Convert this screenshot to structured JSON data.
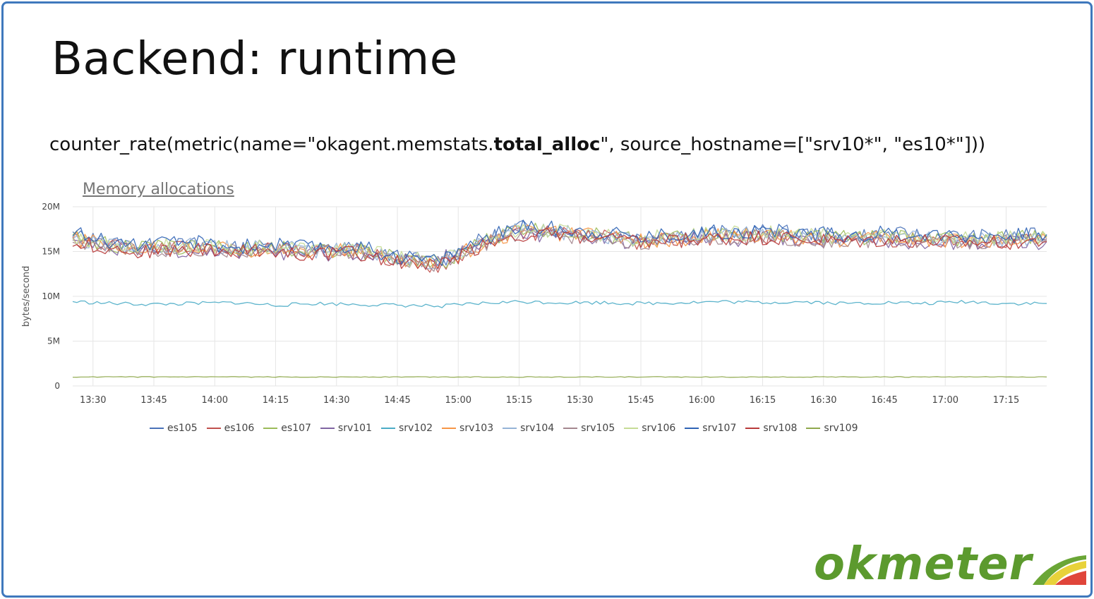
{
  "slide": {
    "title": "Backend: runtime",
    "query": {
      "prefix": "counter_rate(metric(name=\"okagent.memstats.",
      "bold": "total_alloc",
      "suffix": "\", source_hostname=[\"srv10*\", \"es10*\"]))"
    }
  },
  "logo": {
    "text": "okmeter"
  },
  "chart_data": {
    "type": "line",
    "title": "Memory allocations",
    "ylabel": "bytes/second",
    "xlabel": "",
    "ylim": [
      0,
      20000000
    ],
    "yticks": [
      {
        "value": 0,
        "label": "0"
      },
      {
        "value": 5000000,
        "label": "5M"
      },
      {
        "value": 10000000,
        "label": "10M"
      },
      {
        "value": 15000000,
        "label": "15M"
      },
      {
        "value": 20000000,
        "label": "20M"
      }
    ],
    "xrange": [
      "13:25",
      "17:25"
    ],
    "xticks": [
      "13:30",
      "13:45",
      "14:00",
      "14:15",
      "14:30",
      "14:45",
      "15:00",
      "15:15",
      "15:30",
      "15:45",
      "16:00",
      "16:15",
      "16:30",
      "16:45",
      "17:00",
      "17:15"
    ],
    "grid": true,
    "legend_position": "bottom",
    "x": [
      "13:25",
      "13:35",
      "13:45",
      "13:55",
      "14:05",
      "14:15",
      "14:25",
      "14:35",
      "14:45",
      "14:55",
      "15:05",
      "15:15",
      "15:25",
      "15:35",
      "15:45",
      "15:55",
      "16:05",
      "16:15",
      "16:25",
      "16:35",
      "16:45",
      "16:55",
      "17:05",
      "17:15",
      "17:25"
    ],
    "series": [
      {
        "name": "es105",
        "color": "#4a72b8",
        "values": [
          16.8,
          15.9,
          15.6,
          15.8,
          15.3,
          15.7,
          15.2,
          15.4,
          14.4,
          13.8,
          16.1,
          17.7,
          17.4,
          17.0,
          16.5,
          16.9,
          17.1,
          17.2,
          17.0,
          16.7,
          16.9,
          16.8,
          16.6,
          16.7,
          16.8
        ]
      },
      {
        "name": "es106",
        "color": "#c0504d",
        "values": [
          16.3,
          15.5,
          15.1,
          15.4,
          15.0,
          15.2,
          14.8,
          15.0,
          14.0,
          13.4,
          15.6,
          17.2,
          16.9,
          16.6,
          16.0,
          16.4,
          16.6,
          16.7,
          16.5,
          16.2,
          16.4,
          16.3,
          16.1,
          16.2,
          16.3
        ]
      },
      {
        "name": "es107",
        "color": "#9bbb59",
        "values": [
          16.6,
          15.7,
          15.4,
          15.6,
          15.2,
          15.5,
          15.0,
          15.2,
          14.2,
          13.6,
          15.8,
          17.5,
          17.2,
          16.8,
          16.3,
          16.7,
          16.9,
          17.0,
          16.8,
          16.5,
          16.7,
          16.6,
          16.4,
          16.5,
          16.6
        ]
      },
      {
        "name": "srv101",
        "color": "#8064a2",
        "values": [
          16.1,
          15.3,
          14.9,
          15.2,
          14.8,
          15.0,
          14.6,
          14.8,
          13.9,
          14.1,
          15.4,
          17.0,
          16.7,
          16.4,
          15.9,
          16.2,
          16.4,
          16.5,
          16.3,
          16.0,
          16.2,
          16.1,
          15.9,
          16.0,
          16.1
        ]
      },
      {
        "name": "srv102",
        "color": "#4bacc6",
        "values": [
          9.4,
          9.2,
          9.1,
          9.2,
          9.3,
          9.0,
          9.2,
          9.1,
          9.0,
          8.9,
          9.2,
          9.4,
          9.3,
          9.3,
          9.2,
          9.3,
          9.4,
          9.3,
          9.4,
          9.2,
          9.3,
          9.2,
          9.4,
          9.2,
          9.2
        ]
      },
      {
        "name": "srv103",
        "color": "#f79646",
        "values": [
          16.4,
          15.6,
          15.3,
          15.5,
          15.1,
          15.4,
          14.9,
          15.1,
          14.1,
          13.5,
          15.7,
          17.3,
          17.0,
          16.7,
          16.2,
          16.5,
          16.7,
          16.8,
          16.6,
          16.3,
          16.5,
          16.4,
          16.2,
          16.3,
          16.4
        ]
      },
      {
        "name": "srv104",
        "color": "#95b3d7",
        "values": [
          16.5,
          15.8,
          15.5,
          15.7,
          15.3,
          15.6,
          15.1,
          15.3,
          14.3,
          13.7,
          15.9,
          17.4,
          17.1,
          16.8,
          16.3,
          16.6,
          16.8,
          16.9,
          16.7,
          16.4,
          16.6,
          16.5,
          16.3,
          16.4,
          16.5
        ]
      },
      {
        "name": "srv105",
        "color": "#a4878f",
        "values": [
          16.2,
          15.4,
          15.2,
          15.3,
          15.0,
          15.3,
          14.8,
          15.0,
          14.0,
          13.5,
          15.6,
          17.1,
          16.8,
          16.5,
          16.0,
          16.3,
          16.5,
          16.6,
          16.4,
          16.1,
          16.3,
          16.2,
          16.0,
          16.1,
          16.2
        ]
      },
      {
        "name": "srv106",
        "color": "#c5dc95",
        "values": [
          16.7,
          15.9,
          15.5,
          15.8,
          15.4,
          15.6,
          15.1,
          15.3,
          14.3,
          13.8,
          15.9,
          17.5,
          17.2,
          16.9,
          16.4,
          16.8,
          17.0,
          17.1,
          16.9,
          16.6,
          16.8,
          16.7,
          16.5,
          16.6,
          16.7
        ]
      },
      {
        "name": "srv107",
        "color": "#2f63b5",
        "values": [
          17.0,
          16.1,
          15.7,
          16.0,
          15.5,
          15.8,
          15.3,
          15.5,
          14.5,
          13.9,
          16.2,
          17.8,
          17.5,
          17.2,
          16.6,
          17.0,
          17.2,
          17.3,
          17.1,
          16.8,
          17.0,
          16.9,
          16.7,
          16.8,
          16.9
        ]
      },
      {
        "name": "srv108",
        "color": "#b83a3a",
        "values": [
          16.0,
          15.3,
          15.0,
          15.2,
          14.9,
          15.1,
          14.7,
          14.9,
          13.8,
          13.3,
          15.5,
          17.0,
          16.7,
          16.4,
          15.9,
          16.2,
          16.4,
          16.5,
          16.3,
          16.0,
          16.2,
          16.1,
          15.9,
          16.0,
          16.1
        ]
      },
      {
        "name": "srv109",
        "color": "#8fa84c",
        "values": [
          1.0,
          1.0,
          1.0,
          1.0,
          1.0,
          1.0,
          1.0,
          1.0,
          1.0,
          1.0,
          1.0,
          1.0,
          1.0,
          1.0,
          1.0,
          1.0,
          1.0,
          1.0,
          1.0,
          1.0,
          1.0,
          1.0,
          1.0,
          1.0,
          1.0
        ]
      }
    ],
    "value_scale": "millions"
  }
}
